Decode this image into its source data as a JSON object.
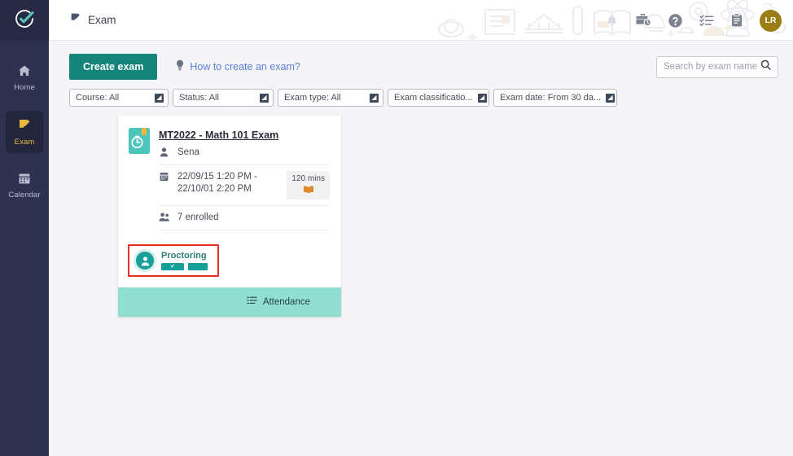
{
  "brand": {
    "logo_icon": "check-circle-logo",
    "accent": "#15857c",
    "sidebar_bg": "#2e3150",
    "active_color": "#e8b93c"
  },
  "sidebar": {
    "items": [
      {
        "label": "Home",
        "icon": "home-icon",
        "active": false
      },
      {
        "label": "Exam",
        "icon": "exam-edit-icon",
        "active": true
      },
      {
        "label": "Calendar",
        "icon": "calendar-icon",
        "active": false
      }
    ]
  },
  "header": {
    "title": "Exam",
    "title_icon": "exam-edit-icon",
    "icons": [
      {
        "name": "bell-icon"
      },
      {
        "name": "briefcase-clock-icon"
      },
      {
        "name": "help-circle-icon"
      },
      {
        "name": "checklist-icon"
      },
      {
        "name": "clipboard-icon"
      }
    ],
    "avatar_initials": "LR",
    "avatar_color": "#9c7c14"
  },
  "toolbar": {
    "create_label": "Create exam",
    "howto_label": "How to create an exam?",
    "howto_icon": "lightbulb-icon"
  },
  "search": {
    "placeholder": "Search by exam name",
    "value": "",
    "icon": "search-icon"
  },
  "filters": [
    {
      "label": "Course: All",
      "name": "course"
    },
    {
      "label": "Status: All",
      "name": "status"
    },
    {
      "label": "Exam type: All",
      "name": "exam-type"
    },
    {
      "label": "Exam classificatio...",
      "name": "exam-classification"
    },
    {
      "label": "Exam date: From 30 da...",
      "name": "exam-date"
    }
  ],
  "exam_card": {
    "thumb_icon": "exam-timer-icon",
    "title": "MT2022 - Math 101 Exam",
    "owner": {
      "icon": "person-icon",
      "text": "Sena"
    },
    "schedule": {
      "icon": "calendar-icon",
      "text": "22/09/15 1:20 PM - 22/10/01 2:20 PM"
    },
    "duration": {
      "text": "120 mins",
      "icon": "open-book-icon"
    },
    "enrolled": {
      "icon": "people-icon",
      "text": "7 enrolled"
    },
    "proctoring": {
      "label": "Proctoring",
      "icon": "proctor-person-icon",
      "highlight_color": "#e8302a",
      "pills": [
        {
          "checked": true
        },
        {
          "checked": false
        }
      ]
    },
    "footer": {
      "label": "Attendance",
      "icon": "attendance-list-icon"
    }
  }
}
